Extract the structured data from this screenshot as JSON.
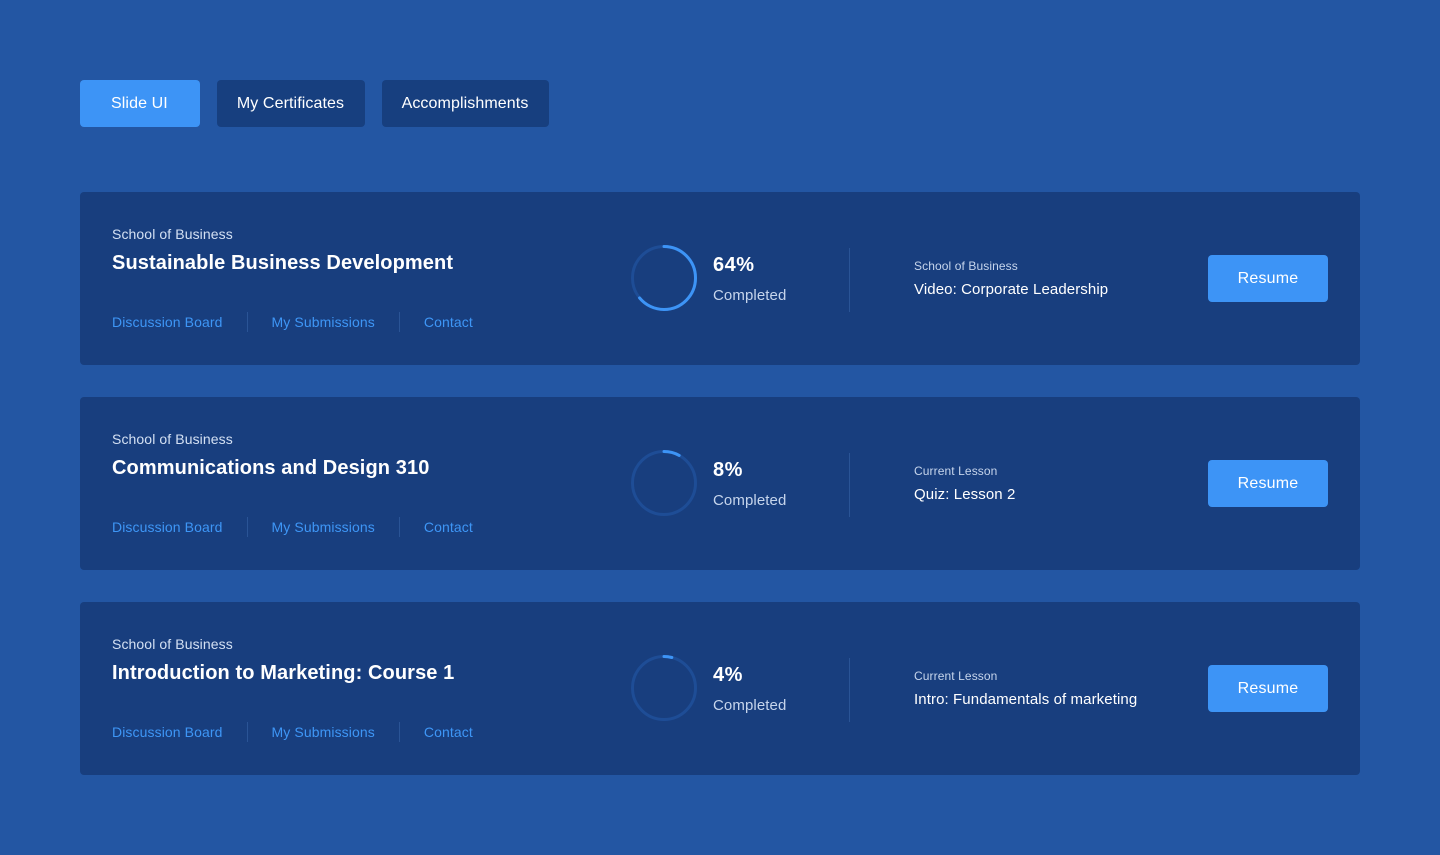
{
  "tabs": [
    {
      "label": "Slide UI",
      "active": true
    },
    {
      "label": "My Certificates",
      "active": false
    },
    {
      "label": "Accomplishments",
      "active": false
    }
  ],
  "colors": {
    "background": "#2356a3",
    "card": "#183e7e",
    "accent": "#3d94f6",
    "link": "#3e96f6",
    "ring_track": "#1e4d96"
  },
  "courses": [
    {
      "school": "School of Business",
      "title": "Sustainable Business Development",
      "links": [
        "Discussion Board",
        "My Submissions",
        "Contact"
      ],
      "progress": 64,
      "progress_text": "64%",
      "progress_label": "Completed",
      "lesson_caption": "School of Business",
      "lesson_title": "Video: Corporate Leadership",
      "button_label": "Resume"
    },
    {
      "school": "School of Business",
      "title": "Communications and Design 310",
      "links": [
        "Discussion Board",
        "My Submissions",
        "Contact"
      ],
      "progress": 8,
      "progress_text": "8%",
      "progress_label": "Completed",
      "lesson_caption": "Current Lesson",
      "lesson_title": "Quiz: Lesson 2",
      "button_label": "Resume"
    },
    {
      "school": "School of Business",
      "title": "Introduction to Marketing: Course 1",
      "links": [
        "Discussion Board",
        "My Submissions",
        "Contact"
      ],
      "progress": 4,
      "progress_text": "4%",
      "progress_label": "Completed",
      "lesson_caption": "Current Lesson",
      "lesson_title": "Intro: Fundamentals of marketing",
      "button_label": "Resume"
    }
  ]
}
